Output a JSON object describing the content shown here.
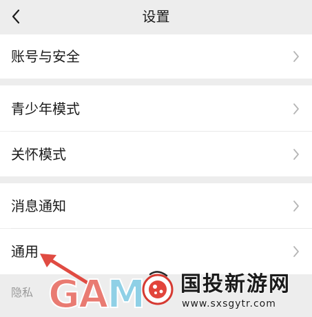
{
  "header": {
    "title": "设置",
    "back_icon": "chevron-left-icon"
  },
  "groups": [
    {
      "items": [
        {
          "label": "账号与安全",
          "icon": "chevron-right-icon"
        }
      ]
    },
    {
      "items": [
        {
          "label": "青少年模式",
          "icon": "chevron-right-icon"
        },
        {
          "label": "关怀模式",
          "icon": "chevron-right-icon"
        }
      ]
    },
    {
      "items": [
        {
          "label": "消息通知",
          "icon": "chevron-right-icon"
        },
        {
          "label": "通用",
          "icon": "chevron-right-icon"
        }
      ]
    }
  ],
  "section": {
    "privacy_title": "隐私"
  },
  "watermark": {
    "gam_text": "GAM",
    "site_name": "国投新游网",
    "site_url": "www.sxsgytr.com"
  },
  "colors": {
    "background": "#ededed",
    "row": "#ffffff",
    "text": "#1b1b1b",
    "chevron": "#b5b5b5",
    "arrow": "#e04b42"
  }
}
